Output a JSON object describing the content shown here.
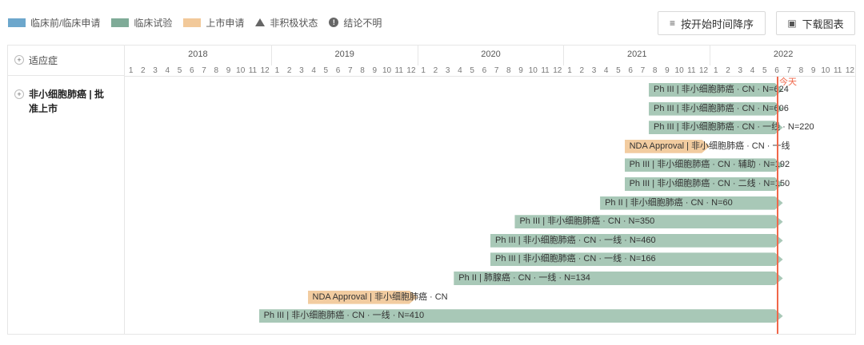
{
  "legend": {
    "items": [
      {
        "label": "临床前/临床申请",
        "color": "#6da7cc",
        "kind": "swatch"
      },
      {
        "label": "临床试验",
        "color": "#7fab98",
        "kind": "swatch"
      },
      {
        "label": "上市申请",
        "color": "#f2c99a",
        "kind": "swatch"
      },
      {
        "label": "非积极状态",
        "color": "#666666",
        "kind": "triangle"
      },
      {
        "label": "结论不明",
        "color": "#666666",
        "kind": "info"
      }
    ]
  },
  "toolbar": {
    "sort_label": "按开始时间降序",
    "download_label": "下载图表"
  },
  "table": {
    "header_label": "适应症",
    "indication_label": "非小细胞肺癌 | 批准上市",
    "expand_symbol": "+"
  },
  "timeline": {
    "years": [
      "2018",
      "2019",
      "2020",
      "2021",
      "2022"
    ],
    "months": [
      "1",
      "2",
      "3",
      "4",
      "5",
      "6",
      "7",
      "8",
      "9",
      "10",
      "11",
      "12"
    ],
    "today_label": "今天",
    "today_color": "#f0674a"
  },
  "chart_data": {
    "type": "gantt",
    "x_unit": "month",
    "x_range": [
      "2018-01",
      "2022-12"
    ],
    "today": "2022-06",
    "colors": {
      "clinical": "#a8c8b7",
      "nda": "#f2ccA0"
    },
    "bars": [
      {
        "label": "Ph III | 非小细胞肺癌 · CN · N=624",
        "start": "2021-08",
        "end": "2022-06",
        "kind": "clinical"
      },
      {
        "label": "Ph III | 非小细胞肺癌 · CN · N=606",
        "start": "2021-08",
        "end": "2022-06",
        "kind": "clinical"
      },
      {
        "label": "Ph III | 非小细胞肺癌 · CN · 一线 · N=220",
        "start": "2021-08",
        "end": "2022-06",
        "kind": "clinical"
      },
      {
        "label": "NDA Approval | 非小细胞肺癌 · CN · 一线",
        "start": "2021-06",
        "end": "2021-12",
        "kind": "nda"
      },
      {
        "label": "Ph III | 非小细胞肺癌 · CN · 辅助 · N=192",
        "start": "2021-06",
        "end": "2022-06",
        "kind": "clinical"
      },
      {
        "label": "Ph III | 非小细胞肺癌 · CN · 二线 · N=150",
        "start": "2021-06",
        "end": "2022-06",
        "kind": "clinical"
      },
      {
        "label": "Ph II | 非小细胞肺癌 · CN · N=60",
        "start": "2021-04",
        "end": "2022-06",
        "kind": "clinical"
      },
      {
        "label": "Ph III | 非小细胞肺癌 · CN · N=350",
        "start": "2020-09",
        "end": "2022-06",
        "kind": "clinical"
      },
      {
        "label": "Ph III | 非小细胞肺癌 · CN · 一线 · N=460",
        "start": "2020-07",
        "end": "2022-06",
        "kind": "clinical"
      },
      {
        "label": "Ph III | 非小细胞肺癌 · CN · 一线 · N=166",
        "start": "2020-07",
        "end": "2022-06",
        "kind": "clinical"
      },
      {
        "label": "Ph II | 肺腺癌 · CN · 一线 · N=134",
        "start": "2020-04",
        "end": "2022-06",
        "kind": "clinical"
      },
      {
        "label": "NDA Approval | 非小细胞肺癌 · CN",
        "start": "2019-04",
        "end": "2019-12",
        "kind": "nda"
      },
      {
        "label": "Ph III | 非小细胞肺癌 · CN · 一线 · N=410",
        "start": "2018-12",
        "end": "2022-06",
        "kind": "clinical"
      }
    ]
  }
}
